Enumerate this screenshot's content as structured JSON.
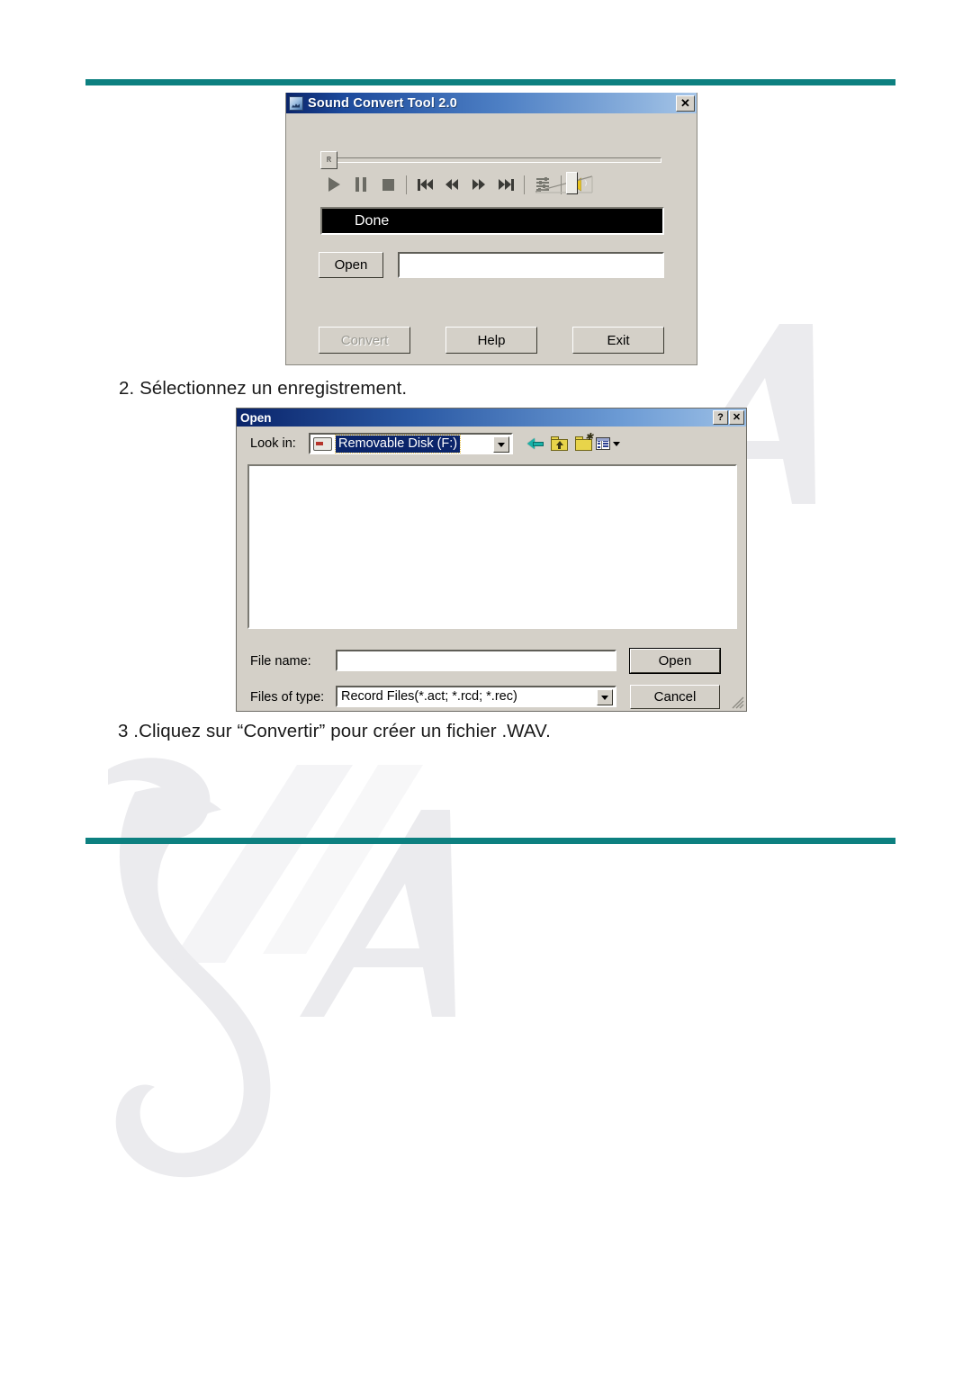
{
  "page": {
    "rule_color": "#0d8080",
    "background": "#ffffff",
    "watermark_color": "#ebebee"
  },
  "steps": {
    "step2": "2. Sélectionnez un enregistrement.",
    "step3": "3 .Cliquez sur “Convertir” pour créer un fichier .WAV."
  },
  "sound_convert_tool": {
    "title": "Sound Convert Tool 2.0",
    "app_icon": "sound-wave-icon",
    "close_label": "✕",
    "seek": {
      "thumb_label": "R",
      "value": 0
    },
    "transport": [
      {
        "name": "play-button",
        "glyph": "play"
      },
      {
        "name": "pause-button",
        "glyph": "pause"
      },
      {
        "name": "stop-button",
        "glyph": "stop"
      },
      {
        "name": "previous-track-button",
        "glyph": "skip-back"
      },
      {
        "name": "rewind-button",
        "glyph": "rewind"
      },
      {
        "name": "fast-forward-button",
        "glyph": "fast-forward"
      },
      {
        "name": "next-track-button",
        "glyph": "skip-forward"
      },
      {
        "name": "equalizer-button",
        "glyph": "equalizer"
      },
      {
        "name": "mute-button",
        "glyph": "speaker"
      }
    ],
    "status_text": "Done",
    "open_label": "Open",
    "path_value": "",
    "path_placeholder": "",
    "convert_label": "Convert",
    "convert_disabled": true,
    "help_label": "Help",
    "exit_label": "Exit"
  },
  "open_dialog": {
    "title": "Open",
    "help_label": "?",
    "close_label": "✕",
    "lookin_label": "Look in:",
    "lookin_value": "Removable Disk (F:)",
    "lookin_icon": "removable-drive-icon",
    "toolbar": [
      {
        "name": "back-icon",
        "tooltip": "Back"
      },
      {
        "name": "up-one-level-icon",
        "tooltip": "Up One Level"
      },
      {
        "name": "new-folder-icon",
        "tooltip": "Create New Folder"
      },
      {
        "name": "views-icon",
        "tooltip": "Views"
      }
    ],
    "file_list_items": [],
    "filename_label": "File name:",
    "filename_value": "",
    "filetype_label": "Files of type:",
    "filetype_value": "Record Files(*.act; *.rcd; *.rec)",
    "open_button": "Open",
    "cancel_button": "Cancel"
  }
}
